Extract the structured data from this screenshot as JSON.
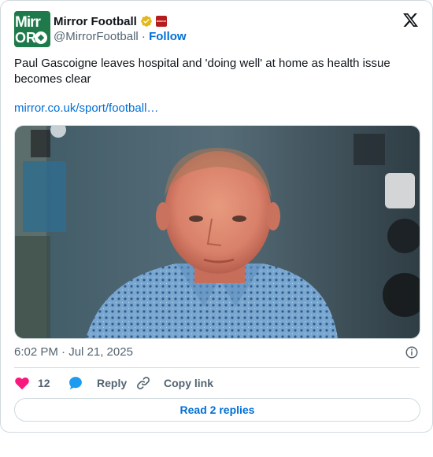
{
  "author": {
    "display_name": "Mirror Football",
    "handle": "@MirrorFootball",
    "separator": "·",
    "follow_label": "Follow",
    "avatar_text_top": "Mirr",
    "avatar_text_bottom": "OR",
    "affiliate_badge_text": "MIRROR"
  },
  "tweet": {
    "text": "Paul Gascoigne leaves hospital and 'doing well' at home as health issue becomes clear",
    "link": "mirror.co.uk/sport/football…",
    "timestamp": "6:02 PM · Jul 21, 2025"
  },
  "actions": {
    "like_count": "12",
    "reply_label": "Reply",
    "copy_link_label": "Copy link"
  },
  "read_replies_label": "Read 2 replies",
  "colors": {
    "brand_blue": "#006fd6",
    "like_pink": "#f91880",
    "reply_blue": "#1d9bf0",
    "verified_gold": "#e2b719",
    "avatar_green": "#1e7a4a"
  },
  "icons": {
    "platform": "x-logo-icon",
    "verified": "verified-badge-icon",
    "like": "heart-icon",
    "reply": "speech-bubble-icon",
    "copy": "link-icon",
    "info": "info-icon"
  }
}
